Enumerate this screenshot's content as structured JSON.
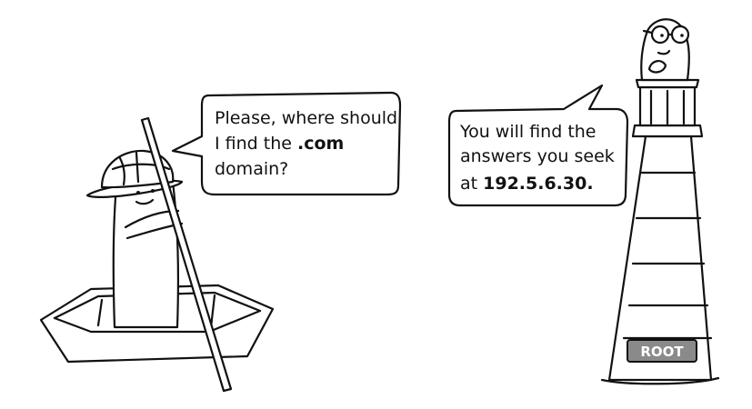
{
  "left_bubble": {
    "line1": "Please, where should",
    "line2_prefix": "I find the ",
    "line2_bold": ".com",
    "line3": "domain?"
  },
  "right_bubble": {
    "line1": "You will find the",
    "line2": "answers you seek",
    "line3_prefix": "at ",
    "line3_bold": "192.5.6.30."
  },
  "lighthouse_plaque": "ROOT",
  "colors": {
    "ink": "#111111",
    "plaque": "#8a8a8a",
    "plaque_text": "#ffffff",
    "water": "#f2f2f2"
  },
  "icons": [
    "boat",
    "pole",
    "explorer-character",
    "pith-helmet",
    "lighthouse",
    "owl-character",
    "glasses"
  ]
}
